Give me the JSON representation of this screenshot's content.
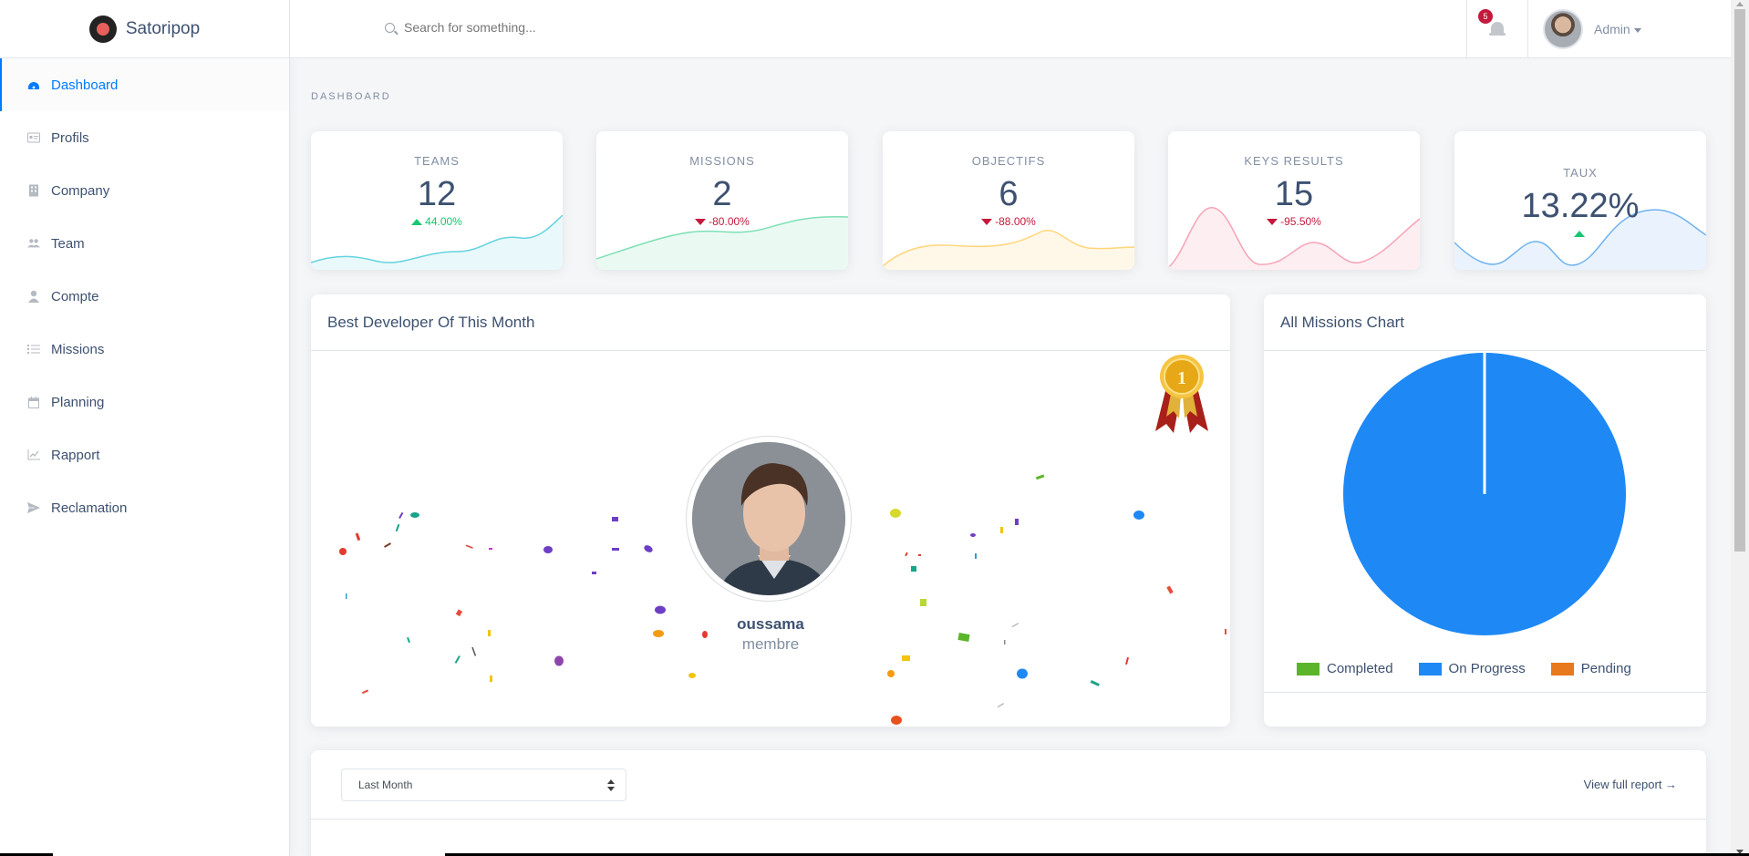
{
  "app": {
    "name": "Satoripop"
  },
  "sidebar": {
    "items": [
      {
        "label": "Dashboard",
        "icon": "dashboard-icon",
        "active": true
      },
      {
        "label": "Profils",
        "icon": "id-card-icon"
      },
      {
        "label": "Company",
        "icon": "building-icon"
      },
      {
        "label": "Team",
        "icon": "users-icon"
      },
      {
        "label": "Compte",
        "icon": "user-icon"
      },
      {
        "label": "Missions",
        "icon": "list-icon"
      },
      {
        "label": "Planning",
        "icon": "calendar-icon"
      },
      {
        "label": "Rapport",
        "icon": "chart-icon"
      },
      {
        "label": "Reclamation",
        "icon": "send-icon"
      }
    ]
  },
  "topbar": {
    "search_placeholder": "Search for something...",
    "notifications_count": "5",
    "user_name": "Admin"
  },
  "page": {
    "subtitle": "DASHBOARD"
  },
  "stats": [
    {
      "label": "TEAMS",
      "value": "12",
      "change": "44.00%",
      "direction": "up",
      "color": "#63d3e0"
    },
    {
      "label": "MISSIONS",
      "value": "2",
      "change": "-80.00%",
      "direction": "down",
      "color": "#7ee0b4"
    },
    {
      "label": "OBJECTIFS",
      "value": "6",
      "change": "-88.00%",
      "direction": "down",
      "color": "#ffd57a"
    },
    {
      "label": "KEYS RESULTS",
      "value": "15",
      "change": "-95.50%",
      "direction": "down",
      "color": "#f7a3b7"
    },
    {
      "label": "TAUX",
      "value": "13.22%",
      "change": "",
      "direction": "up",
      "color": "#6fb2f0"
    }
  ],
  "best_developer": {
    "title": "Best Developer Of This Month",
    "name": "oussama",
    "role": "membre",
    "medal_number": "1"
  },
  "missions_chart": {
    "title": "All Missions Chart",
    "legend": [
      {
        "label": "Completed",
        "color": "#5bb52b"
      },
      {
        "label": "On Progress",
        "color": "#1e88f5"
      },
      {
        "label": "Pending",
        "color": "#e8791d"
      }
    ]
  },
  "chart_data": {
    "type": "pie",
    "title": "All Missions Chart",
    "categories": [
      "Completed",
      "On Progress",
      "Pending"
    ],
    "values": [
      0,
      100,
      0
    ]
  },
  "report": {
    "period_selected": "Last Month",
    "link_label": "View full report →"
  }
}
